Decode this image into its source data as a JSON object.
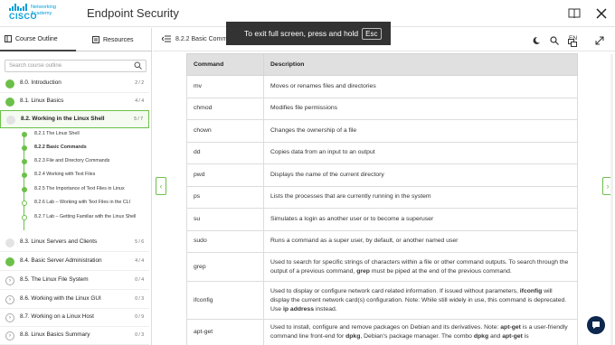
{
  "header": {
    "logo_brand": "CISCO",
    "logo_sub1": "Networking",
    "logo_sub2": "Academy",
    "title": "Endpoint Security"
  },
  "fullscreen_notice": {
    "text": "To exit full screen, press and hold",
    "key": "Esc"
  },
  "sidebar": {
    "tab_outline": "Course Outline",
    "tab_resources": "Resources",
    "search_placeholder": "Search course outline",
    "modules": [
      {
        "label": "8.0. Introduction",
        "count": "2 / 2",
        "state": "done"
      },
      {
        "label": "8.1. Linux Basics",
        "count": "4 / 4",
        "state": "done"
      },
      {
        "label": "8.2. Working in the Linux Shell",
        "count": "5 / 7",
        "state": "active"
      },
      {
        "label": "8.3. Linux Servers and Clients",
        "count": "5 / 6",
        "state": "partial"
      },
      {
        "label": "8.4. Basic Server Administration",
        "count": "4 / 4",
        "state": "done"
      },
      {
        "label": "8.5. The Linux File System",
        "count": "0 / 4",
        "state": "open"
      },
      {
        "label": "8.6. Working with the Linux GUI",
        "count": "0 / 3",
        "state": "open"
      },
      {
        "label": "8.7. Working on a Linux Host",
        "count": "0 / 9",
        "state": "open"
      },
      {
        "label": "8.8. Linux Basics Summary",
        "count": "0 / 3",
        "state": "open"
      }
    ],
    "subitems": [
      "8.2.1 The Linux Shell",
      "8.2.2 Basic Commands",
      "8.2.3 File and Directory Commands",
      "8.2.4 Working with Text Files",
      "8.2.5 The Importance of Text Files in Linux",
      "8.2.6 Lab – Working with Text Files in the CLI",
      "8.2.7 Lab – Getting Familiar with the Linux Shell"
    ]
  },
  "content": {
    "breadcrumb": "8.2.2 Basic Comm",
    "lang": "EN",
    "table": {
      "headers": [
        "Command",
        "Description"
      ],
      "rows": [
        [
          "mv",
          "Moves or renames files and directories"
        ],
        [
          "chmod",
          "Modifies file permissions"
        ],
        [
          "chown",
          "Changes the ownership of a file"
        ],
        [
          "dd",
          "Copies data from an input to an output"
        ],
        [
          "pwd",
          "Displays the name of the current directory"
        ],
        [
          "ps",
          "Lists the processes that are currently running in the system"
        ],
        [
          "su",
          "Simulates a login as another user or to become a superuser"
        ],
        [
          "sudo",
          "Runs a command as a super user, by default, or another named user"
        ]
      ],
      "grep": {
        "cmd": "grep",
        "d1": "Used to search for specific strings of characters within a file or other command outputs. To search through the output of a previous command, ",
        "d_bold": "grep",
        "d2": " must be piped at the end of the previous command."
      },
      "ifconfig": {
        "cmd": "ifconfig",
        "d1": "Used to display or configure network card related information. If issued without parameters, ",
        "d_bold1": "ifconfig",
        "d2": " will display the current network card(s) configuration. Note: While still widely in use, this command is deprecated. Use ",
        "d_bold2": "ip address",
        "d3": " instead."
      },
      "aptget": {
        "cmd": "apt-get",
        "d1": "Used to install, configure and remove packages on Debian and its derivatives. Note: ",
        "d_bold1": "apt-get",
        "d2": " is a user-friendly command line front-end for ",
        "d_bold2": "dpkg",
        "d3": ", Debian's package manager. The combo ",
        "d_bold3": "dpkg",
        "d4": " and ",
        "d_bold4": "apt-get",
        "d5": " is"
      }
    }
  },
  "colors": {
    "accent_green": "#6cc04a",
    "cisco_blue": "#049fd9"
  }
}
